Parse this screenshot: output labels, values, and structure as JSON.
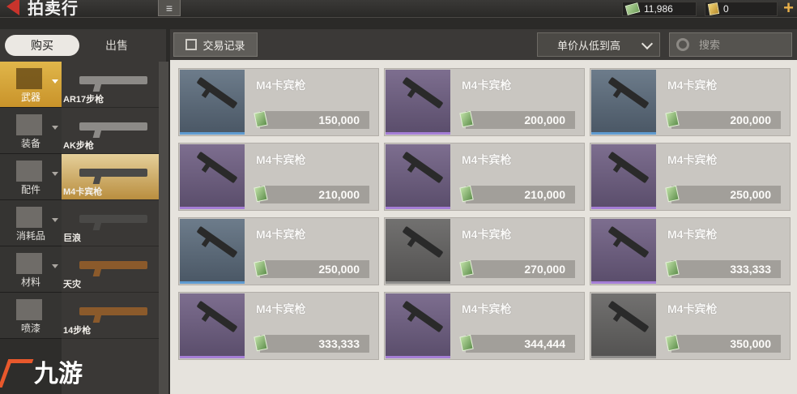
{
  "header": {
    "title": "拍卖行",
    "menu_icon": "hamburger-icon",
    "money": "11,986",
    "gold": "0",
    "plus": "+"
  },
  "tabs": {
    "buy": "购买",
    "sell": "出售"
  },
  "categories": [
    {
      "label": "武器",
      "icon": "pistol-icon"
    },
    {
      "label": "装备",
      "icon": "vest-icon"
    },
    {
      "label": "配件",
      "icon": "magazine-icon"
    },
    {
      "label": "消耗品",
      "icon": "medkit-icon"
    },
    {
      "label": "材料",
      "icon": "gear-icon"
    },
    {
      "label": "喷漆",
      "icon": "spray-can-icon"
    }
  ],
  "guns": [
    {
      "label": "AR17步枪"
    },
    {
      "label": "AK步枪"
    },
    {
      "label": "M4卡宾枪"
    },
    {
      "label": "巨浪"
    },
    {
      "label": "天灾"
    },
    {
      "label": "14步枪"
    }
  ],
  "toolbar": {
    "trade_log": "交易记录",
    "sort": "单价从低到高",
    "search_placeholder": "搜索"
  },
  "listings": [
    {
      "name": "M4卡宾枪",
      "price": "150,000"
    },
    {
      "name": "M4卡宾枪",
      "price": "200,000"
    },
    {
      "name": "M4卡宾枪",
      "price": "200,000"
    },
    {
      "name": "M4卡宾枪",
      "price": "210,000"
    },
    {
      "name": "M4卡宾枪",
      "price": "210,000"
    },
    {
      "name": "M4卡宾枪",
      "price": "250,000"
    },
    {
      "name": "M4卡宾枪",
      "price": "250,000"
    },
    {
      "name": "M4卡宾枪",
      "price": "270,000"
    },
    {
      "name": "M4卡宾枪",
      "price": "333,333"
    },
    {
      "name": "M4卡宾枪",
      "price": "333,333"
    },
    {
      "name": "M4卡宾枪",
      "price": "344,444"
    },
    {
      "name": "M4卡宾枪",
      "price": "350,000"
    }
  ],
  "watermark": "九游",
  "colors": {
    "accent": "#c8342c",
    "active_category": "#d8a63c"
  }
}
